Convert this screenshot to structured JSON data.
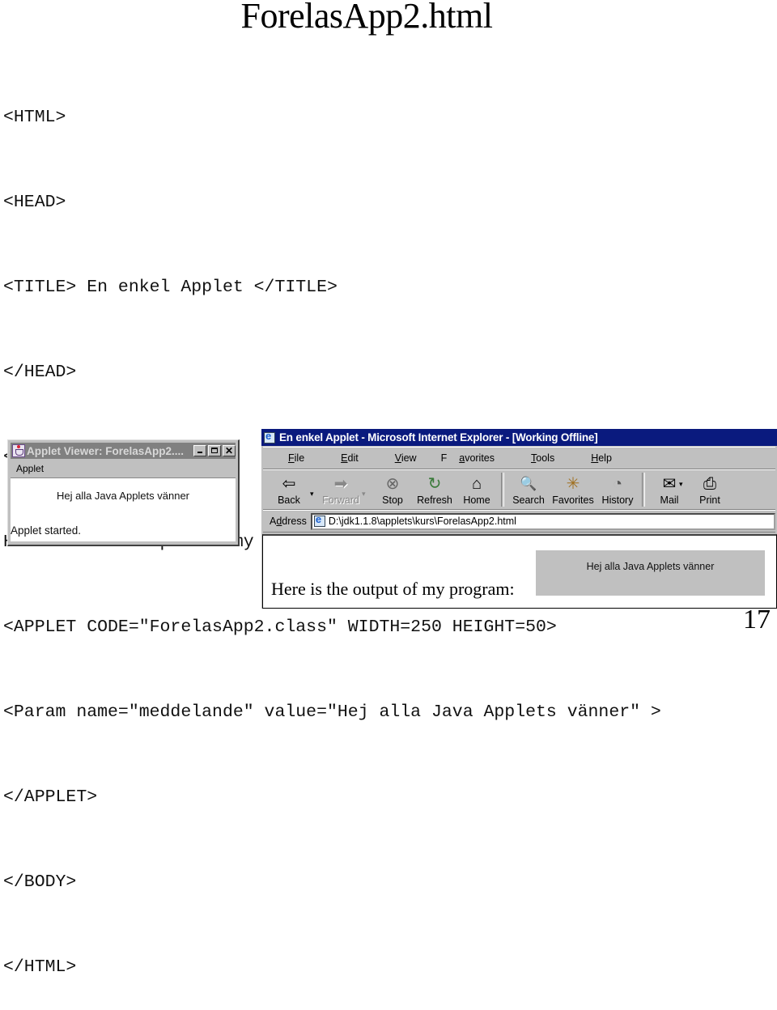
{
  "slide": {
    "title": "ForelasApp2.html",
    "page_number": "17"
  },
  "code_lines": [
    "<HTML>",
    "<HEAD>",
    "<TITLE> En enkel Applet </TITLE>",
    "</HEAD>",
    "<BODY>",
    "Here is the output of my program:",
    "<APPLET CODE=\"ForelasApp2.class\" WIDTH=250 HEIGHT=50>",
    "<Param name=\"meddelande\" value=\"Hej alla Java Applets vänner\" >",
    "</APPLET>",
    "</BODY>",
    "</HTML>"
  ],
  "applet_viewer": {
    "title": "Applet Viewer: ForelasApp2....",
    "menu": "Applet",
    "message": "Hej alla Java Applets vänner",
    "status": "Applet started.",
    "buttons": {
      "minimize": "_",
      "maximize": "□",
      "close": "✕"
    }
  },
  "ie": {
    "title": "En enkel Applet - Microsoft Internet Explorer - [Working Offline]",
    "menu": [
      {
        "pre": "",
        "u": "F",
        "post": "ile"
      },
      {
        "pre": "",
        "u": "E",
        "post": "dit"
      },
      {
        "pre": "",
        "u": "V",
        "post": "iew"
      },
      {
        "pre": "F",
        "u": "a",
        "post": "vorites"
      },
      {
        "pre": "",
        "u": "T",
        "post": "ools"
      },
      {
        "pre": "",
        "u": "H",
        "post": "elp"
      }
    ],
    "toolbar": {
      "back": {
        "label": "Back",
        "glyph": "⇦"
      },
      "forward": {
        "label": "Forward",
        "glyph": "➡"
      },
      "stop": {
        "label": "Stop",
        "glyph": "⊗"
      },
      "refresh": {
        "label": "Refresh",
        "glyph": "↻"
      },
      "home": {
        "label": "Home",
        "glyph": "⌂"
      },
      "search": {
        "label": "Search",
        "glyph": "🔍"
      },
      "favorites": {
        "label": "Favorites",
        "glyph": "✳"
      },
      "history": {
        "label": "History",
        "glyph": "◔"
      },
      "mail": {
        "label": "Mail",
        "glyph": "✉"
      },
      "print": {
        "label": "Print",
        "glyph": "⎙"
      },
      "dropdown": "▾"
    },
    "address": {
      "label_pre": "A",
      "label_u": "d",
      "label_post": "dress",
      "value": "D:\\jdk1.1.8\\applets\\kurs\\ForelasApp2.html"
    },
    "page_text": "Here is the output of my program:",
    "applet_message": "Hej alla Java Applets vänner"
  }
}
